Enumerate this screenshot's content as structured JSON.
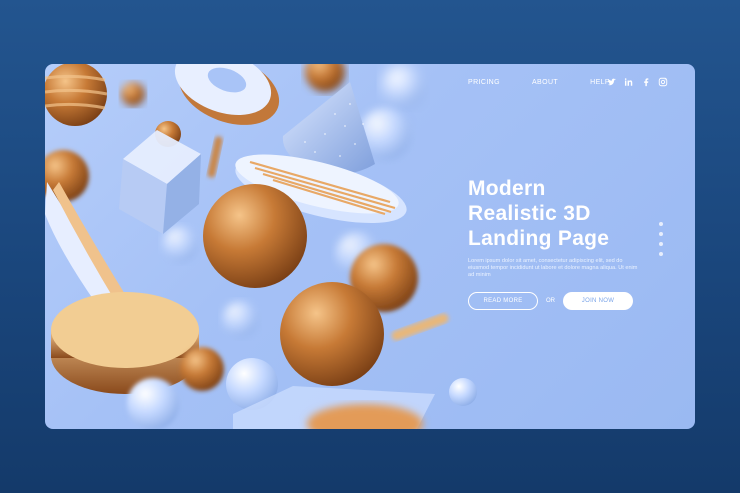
{
  "nav": {
    "items": [
      "PRICING",
      "ABOUT",
      "HELP"
    ],
    "social_icons": [
      "twitter-icon",
      "linkedin-icon",
      "facebook-icon",
      "instagram-icon"
    ]
  },
  "hero": {
    "title_lines": [
      "Modern",
      "Realistic 3D",
      "Landing Page"
    ],
    "description": "Lorem ipsum dolor sit amet, consectetur adipiscing elit, sed do eiusmod tempor incididunt ut labore et dolore magna aliqua. Ut enim ad minim",
    "read_more_label": "READ MORE",
    "or_label": "OR",
    "join_now_label": "JOIN NOW"
  },
  "pagination": {
    "count": 4
  },
  "colors": {
    "page_bg": "#1e4c86",
    "card_bg": "#a9c4f7",
    "orange": "#c87a3a",
    "light_blue": "#cfe0ff"
  }
}
